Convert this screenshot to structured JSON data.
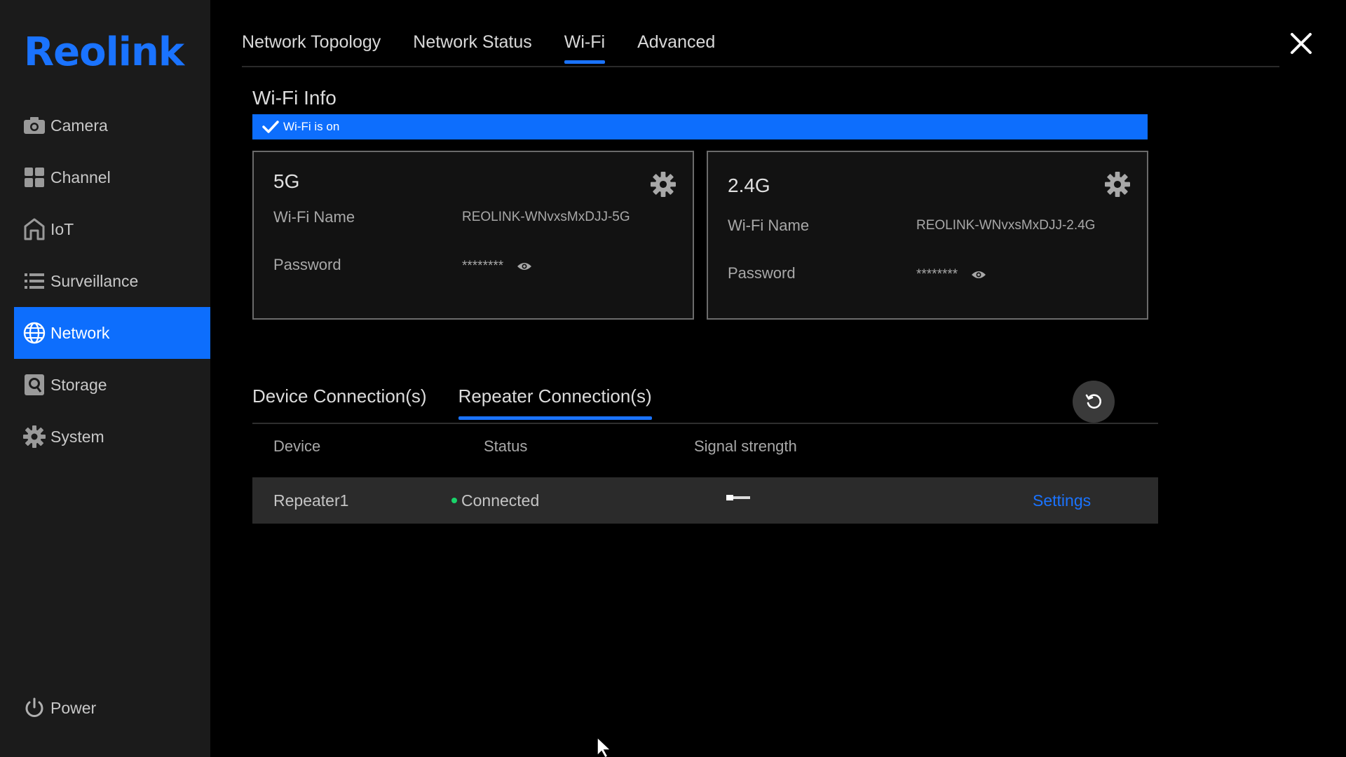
{
  "brand": {
    "logo_text": "Reolink",
    "accent": "#0d6efd"
  },
  "sidebar": {
    "items": [
      {
        "label": "Camera",
        "icon": "camera-icon",
        "active": false
      },
      {
        "label": "Channel",
        "icon": "grid-icon",
        "active": false
      },
      {
        "label": "IoT",
        "icon": "home-icon",
        "active": false
      },
      {
        "label": "Surveillance",
        "icon": "list-icon",
        "active": false
      },
      {
        "label": "Network",
        "icon": "globe-icon",
        "active": true
      },
      {
        "label": "Storage",
        "icon": "storage-icon",
        "active": false
      },
      {
        "label": "System",
        "icon": "gear-icon",
        "active": false
      }
    ],
    "power_label": "Power"
  },
  "tabs": [
    {
      "label": "Network Topology",
      "active": false
    },
    {
      "label": "Network Status",
      "active": false
    },
    {
      "label": "Wi-Fi",
      "active": true
    },
    {
      "label": "Advanced",
      "active": false
    }
  ],
  "wifi_info": {
    "title": "Wi-Fi Info",
    "status_text": "Wi-Fi is on",
    "bands": [
      {
        "band": "5G",
        "name_label": "Wi-Fi Name",
        "name_value": "REOLINK-WNvxsMxDJJ-5G",
        "password_label": "Password",
        "password_value": "********"
      },
      {
        "band": "2.4G",
        "name_label": "Wi-Fi Name",
        "name_value": "REOLINK-WNvxsMxDJJ-2.4G",
        "password_label": "Password",
        "password_value": "********"
      }
    ]
  },
  "connections": {
    "tabs": [
      {
        "label": "Device Connection(s)",
        "active": false
      },
      {
        "label": "Repeater Connection(s)",
        "active": true
      }
    ],
    "columns": [
      "Device",
      "Status",
      "Signal strength"
    ],
    "rows": [
      {
        "device": "Repeater1",
        "status": "Connected",
        "status_color": "#19d46a",
        "signal_level": 0.25,
        "action": "Settings"
      }
    ]
  }
}
